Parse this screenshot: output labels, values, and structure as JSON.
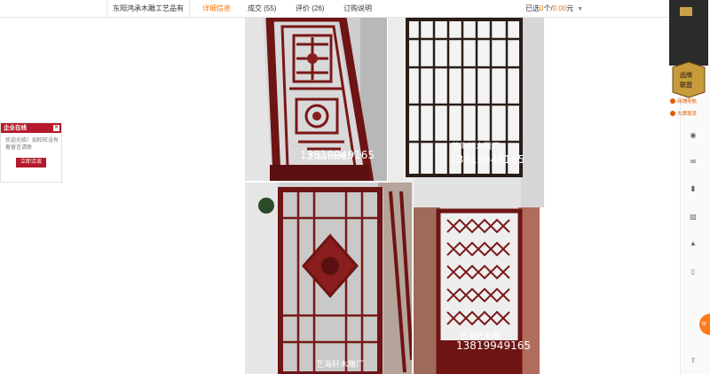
{
  "topbar": {
    "company": "东阳鸿承木雕工艺品有",
    "tabs": [
      {
        "label": "详细信息",
        "active": true
      },
      {
        "label": "成交 (55)",
        "active": false
      },
      {
        "label": "评价 (26)",
        "active": false
      },
      {
        "label": "订购说明",
        "active": false
      }
    ],
    "cart": {
      "prefix": "已选",
      "count": "0",
      "mid": "个/",
      "price": "0.00",
      "suffix": "元"
    }
  },
  "chat": {
    "title": "企业在线",
    "close": "×",
    "message": "欢迎光临！如旺旺没有着留言请联",
    "button": "立即洽谈"
  },
  "photos": {
    "watermark": "艺海轩木雕厂",
    "phone": "13819949165"
  },
  "right_badge": {
    "line1": "品牌",
    "line2": "联盟",
    "nav1": "商铺导航",
    "nav2": "大牌现货"
  },
  "float_button": "8/",
  "colors": {
    "accent": "#ff7300",
    "chat_red": "#b5192b",
    "wood": "#6e1414",
    "frame_dark": "#2a1c16"
  },
  "icons": [
    "chevron-down-icon",
    "close-icon",
    "location-icon",
    "mail-icon",
    "bookmark-icon",
    "book-icon",
    "bell-icon",
    "edit-icon",
    "back-to-top-icon"
  ]
}
